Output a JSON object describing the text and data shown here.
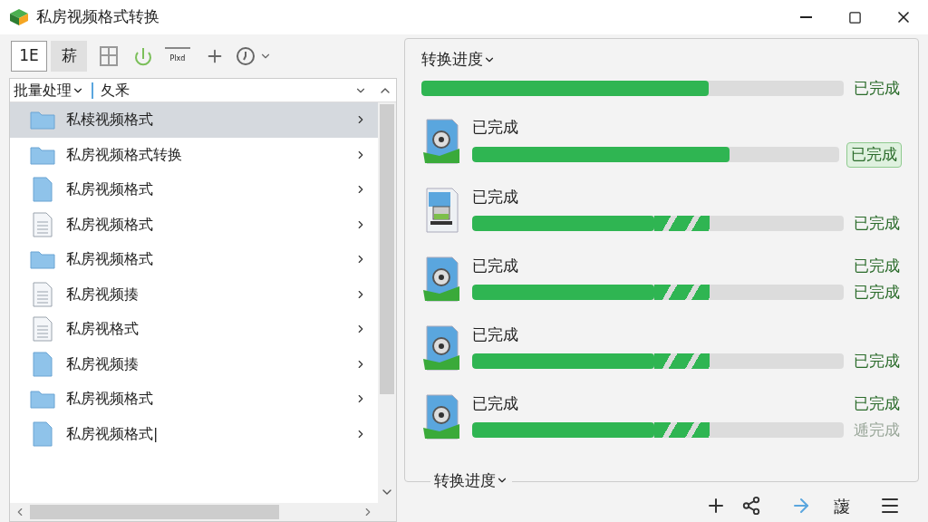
{
  "window": {
    "title": "私房视频格式转换"
  },
  "toolbar": [
    {
      "label": "1E",
      "selected": true
    },
    {
      "label": "菥",
      "selected": false
    }
  ],
  "toolbar_caption": "Plxd",
  "list_header": {
    "menu": "批量处理",
    "filter": "夂釆"
  },
  "files": [
    {
      "name": "私椟视频格式",
      "kind": "folder",
      "selected": true
    },
    {
      "name": "私房视频格式转换",
      "kind": "folder",
      "selected": false
    },
    {
      "name": "私房视频格式",
      "kind": "file",
      "selected": false
    },
    {
      "name": "私房视频格式",
      "kind": "doc",
      "selected": false
    },
    {
      "name": "私房视频格式",
      "kind": "folder",
      "selected": false
    },
    {
      "name": "私房视频揍",
      "kind": "doc",
      "selected": false
    },
    {
      "name": "私房视格式",
      "kind": "doc",
      "selected": false
    },
    {
      "name": "私房视频揍",
      "kind": "file",
      "selected": false
    },
    {
      "name": "私房视频格式",
      "kind": "folder",
      "selected": false
    },
    {
      "name": "私房视频格式|",
      "kind": "file",
      "selected": false
    }
  ],
  "progress_tab": "转换进度",
  "overall": {
    "level": 0.68,
    "status": "已完成"
  },
  "tasks": [
    {
      "kind": "video",
      "busy": false,
      "title": "已完成",
      "level": 0.7,
      "status": {
        "text": "已完成",
        "kind": "boxed"
      }
    },
    {
      "kind": "image",
      "busy": true,
      "title": "已完成",
      "level": 0.49,
      "status": {
        "text": "已完成",
        "kind": "plain"
      }
    },
    {
      "kind": "video",
      "busy": true,
      "title": "已完成",
      "level": 0.49,
      "status_top": "已完成",
      "status": {
        "text": "已完成",
        "kind": "plain"
      }
    },
    {
      "kind": "video",
      "busy": true,
      "title": "已完成",
      "level": 0.49,
      "status": {
        "text": "已完成",
        "kind": "plain"
      }
    },
    {
      "kind": "video",
      "busy": true,
      "title": "已完成",
      "level": 0.49,
      "status_top": "已完成",
      "status": {
        "text": "逓完成",
        "kind": "dim"
      }
    }
  ],
  "footer_tab": "转换进度",
  "bottom_button": "蘐"
}
